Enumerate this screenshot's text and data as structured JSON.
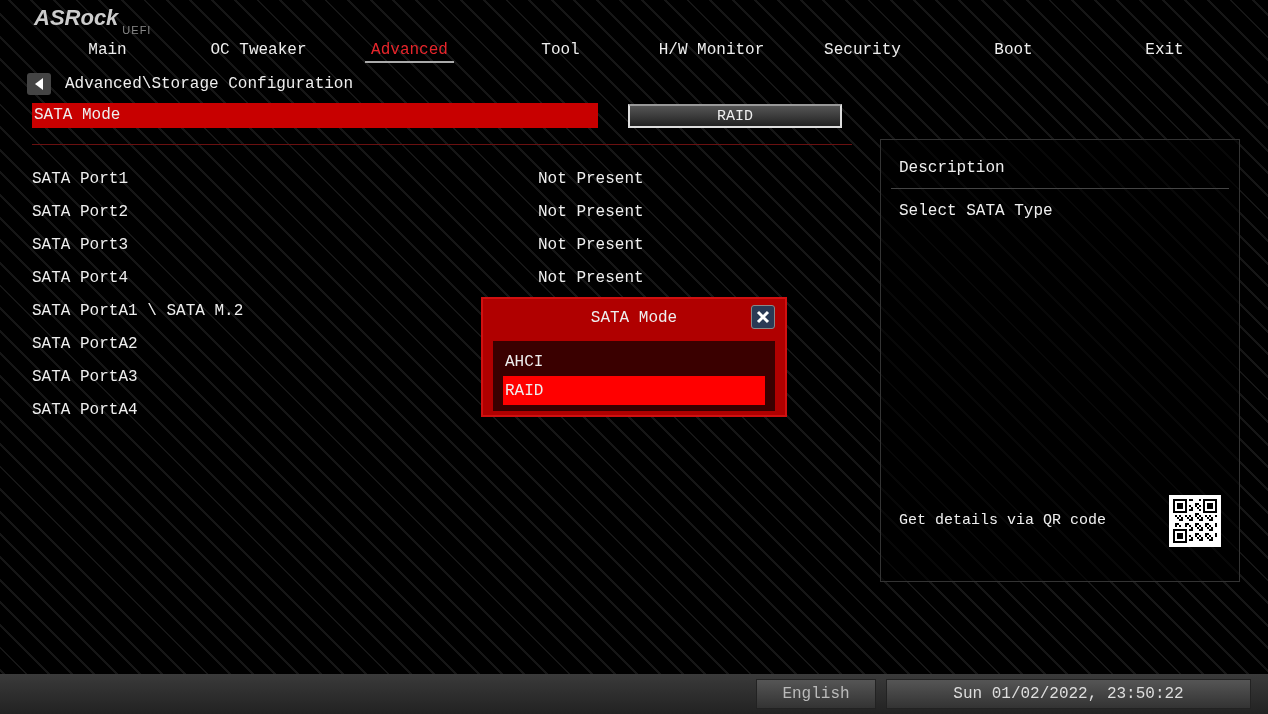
{
  "logo": {
    "brand": "ASRock",
    "sub": "UEFI"
  },
  "tabs": [
    {
      "label": "Main",
      "selected": false
    },
    {
      "label": "OC Tweaker",
      "selected": false
    },
    {
      "label": "Advanced",
      "selected": true
    },
    {
      "label": "Tool",
      "selected": false
    },
    {
      "label": "H/W Monitor",
      "selected": false
    },
    {
      "label": "Security",
      "selected": false
    },
    {
      "label": "Boot",
      "selected": false
    },
    {
      "label": "Exit",
      "selected": false
    }
  ],
  "breadcrumb": "Advanced\\Storage Configuration",
  "setting": {
    "label": "SATA Mode",
    "value": "RAID",
    "selected": true
  },
  "ports": [
    {
      "name": "SATA Port1",
      "value": "Not Present"
    },
    {
      "name": "SATA Port2",
      "value": "Not Present"
    },
    {
      "name": "SATA Port3",
      "value": "Not Present"
    },
    {
      "name": "SATA Port4",
      "value": "Not Present"
    },
    {
      "name": "SATA PortA1 \\ SATA M.2"
    },
    {
      "name": "SATA PortA2"
    },
    {
      "name": "SATA PortA3"
    },
    {
      "name": "SATA PortA4"
    }
  ],
  "popup": {
    "title": "SATA Mode",
    "options": [
      {
        "label": "AHCI",
        "selected": false
      },
      {
        "label": "RAID",
        "selected": true
      }
    ]
  },
  "description": {
    "title": "Description",
    "text": "Select SATA Type",
    "qr_label": "Get details via QR code"
  },
  "status_bar": {
    "language": "English",
    "datetime": "Sun 01/02/2022, 23:50:22"
  }
}
